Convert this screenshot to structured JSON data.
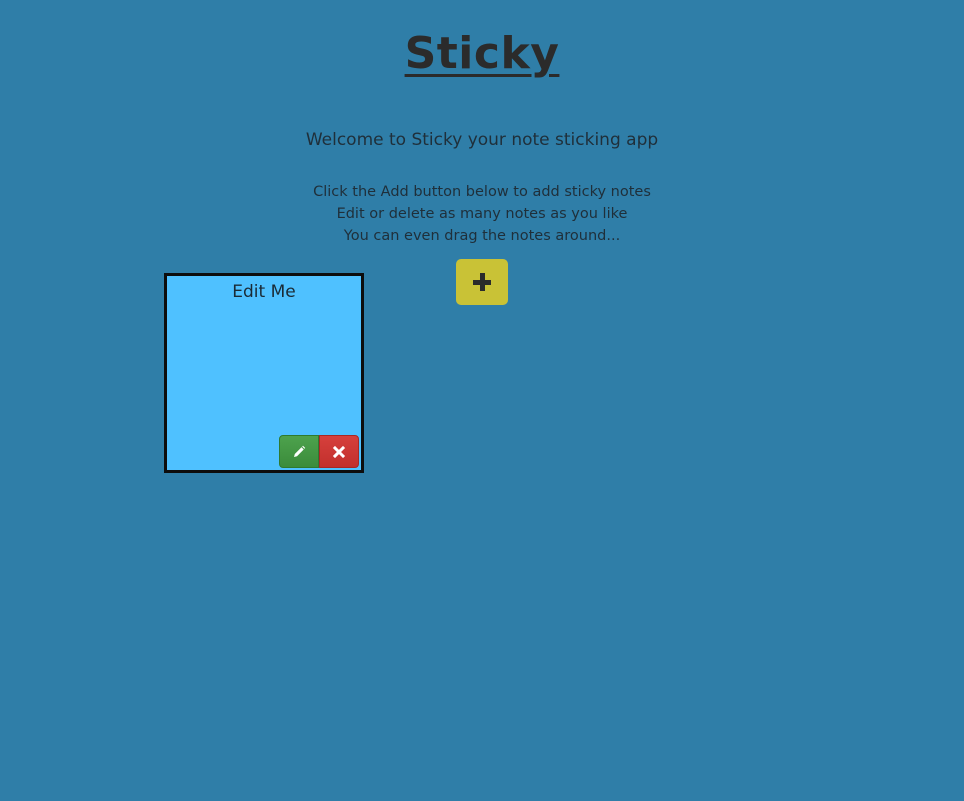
{
  "header": {
    "title": "Sticky",
    "welcome": "Welcome to Sticky your note sticking app"
  },
  "instructions": [
    "Click the Add button below to add sticky notes",
    "Edit or delete as many notes as you like",
    "You can even drag the notes around..."
  ],
  "add_button": {
    "icon": "plus-icon",
    "color": "#c9c236"
  },
  "notes": [
    {
      "text": "Edit Me",
      "color": "#4fc1ff",
      "edit_icon": "pencil-icon",
      "delete_icon": "close-icon"
    }
  ],
  "colors": {
    "background": "#2f7ea8",
    "edit": "#449d44",
    "delete": "#c9302c"
  }
}
